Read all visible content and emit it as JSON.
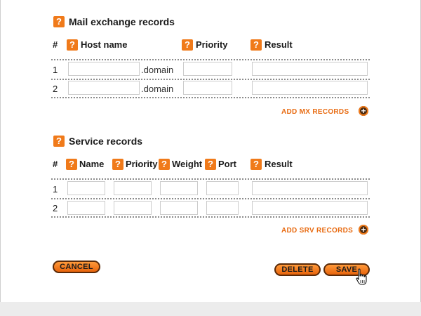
{
  "help_glyph": "?",
  "mx": {
    "title": "Mail exchange records",
    "columns": {
      "num": "#",
      "host": "Host name",
      "priority": "Priority",
      "result": "Result"
    },
    "rows": [
      {
        "num": "1",
        "host": "",
        "suffix": ".domain",
        "priority": "",
        "result": ""
      },
      {
        "num": "2",
        "host": "",
        "suffix": ".domain",
        "priority": "",
        "result": ""
      }
    ],
    "add_label": "ADD MX RECORDS"
  },
  "srv": {
    "title": "Service records",
    "columns": {
      "num": "#",
      "name": "Name",
      "priority": "Priority",
      "weight": "Weight",
      "port": "Port",
      "result": "Result"
    },
    "rows": [
      {
        "num": "1",
        "name": "",
        "priority": "",
        "weight": "",
        "port": "",
        "result": ""
      },
      {
        "num": "2",
        "name": "",
        "priority": "",
        "weight": "",
        "port": "",
        "result": ""
      }
    ],
    "add_label": "ADD SRV RECORDS"
  },
  "plus_glyph": "+",
  "buttons": {
    "cancel": "CANCEL",
    "delete": "DELETE",
    "save": "SAVE"
  },
  "colors": {
    "accent": "#f07a1a",
    "link": "#e86a10",
    "button_border": "#5a2a08"
  },
  "icons": {
    "help": "question-mark-icon",
    "add": "plus-circle-icon",
    "cursor": "hand-pointer-icon"
  }
}
